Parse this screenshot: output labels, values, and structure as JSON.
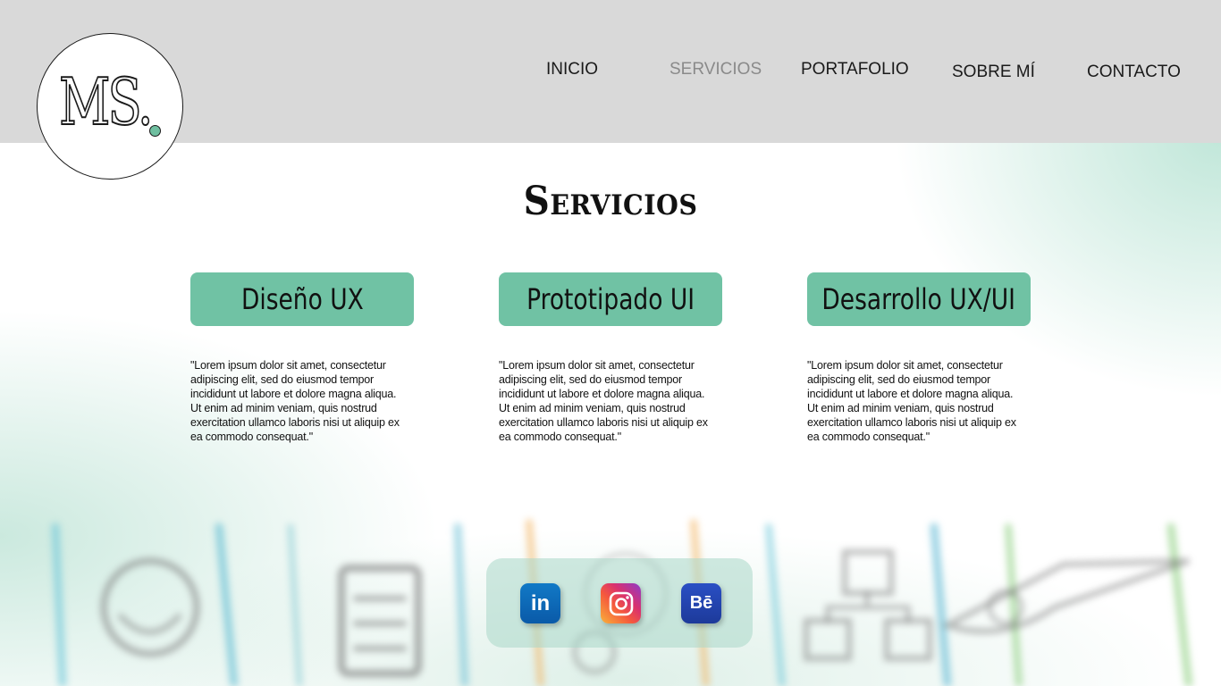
{
  "header": {
    "logo": {
      "text": "MS."
    },
    "nav": [
      {
        "label": "INICIO",
        "active": false
      },
      {
        "label": "SERVICIOS",
        "active": true
      },
      {
        "label": "PORTAFOLIO",
        "active": false
      },
      {
        "label": "SOBRE MÍ",
        "active": false
      },
      {
        "label": "CONTACTO",
        "active": false
      }
    ]
  },
  "main": {
    "title": "Servicios",
    "services": [
      {
        "label": "Diseño UX",
        "description": "\"Lorem ipsum dolor sit amet, consectetur adipiscing elit, sed do eiusmod tempor incididunt ut labore et dolore magna aliqua. Ut enim ad minim veniam, quis nostrud exercitation ullamco laboris nisi ut aliquip ex ea commodo consequat.\""
      },
      {
        "label": "Prototipado UI",
        "description": "\"Lorem ipsum dolor sit amet, consectetur adipiscing elit, sed do eiusmod tempor incididunt ut labore et dolore magna aliqua. Ut enim ad minim veniam, quis nostrud exercitation ullamco laboris nisi ut aliquip ex ea commodo consequat.\""
      },
      {
        "label": "Desarrollo UX/UI",
        "description": "\"Lorem ipsum dolor sit amet, consectetur adipiscing elit, sed do eiusmod tempor incididunt ut labore et dolore magna aliqua. Ut enim ad minim veniam, quis nostrud exercitation ullamco laboris nisi ut aliquip ex ea commodo consequat.\""
      }
    ]
  },
  "social": {
    "icons": [
      {
        "name": "linkedin-icon",
        "glyph": "in"
      },
      {
        "name": "instagram-icon",
        "glyph": ""
      },
      {
        "name": "behance-icon",
        "glyph": "Bē"
      }
    ]
  },
  "colors": {
    "accent": "#70c2a4",
    "header_bg": "#d9d9d9",
    "nav_active": "#8a8a8a",
    "text": "#111111"
  }
}
